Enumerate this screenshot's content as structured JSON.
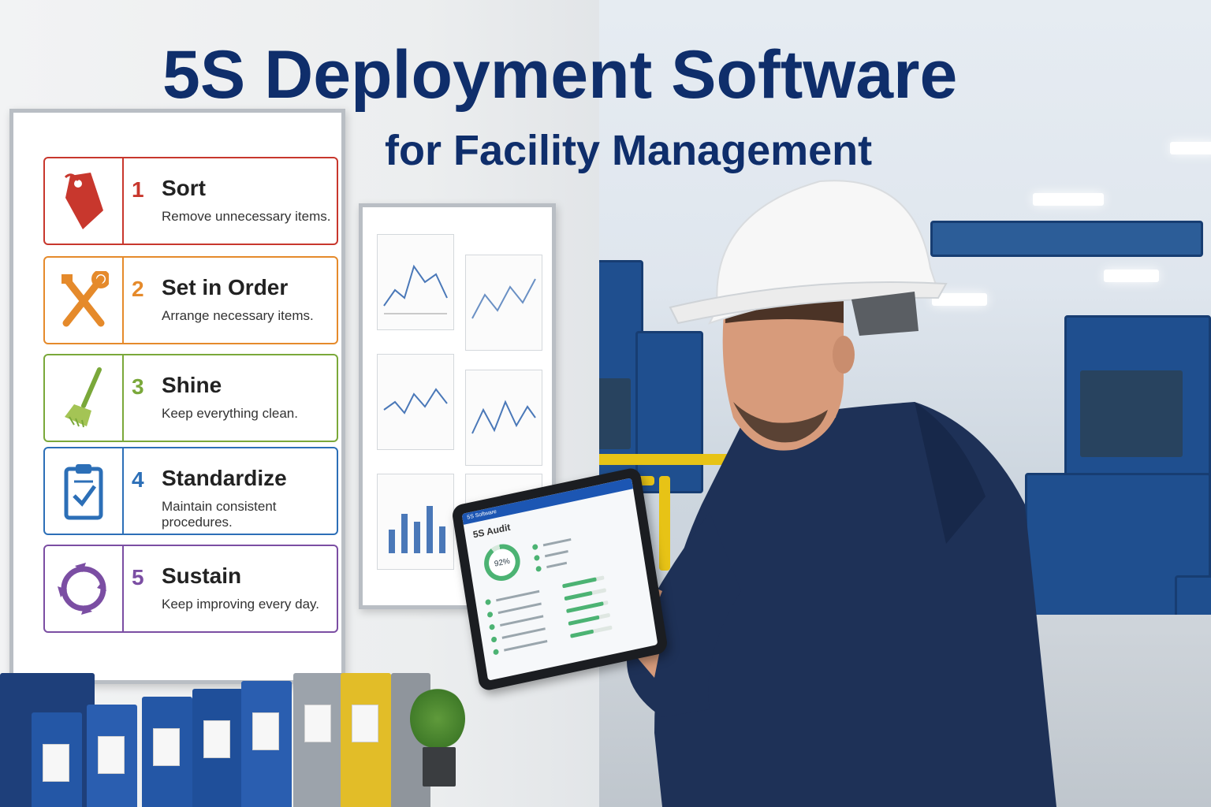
{
  "heading": {
    "title": "5S Deployment Software",
    "subtitle": "for Facility Management"
  },
  "board_5s": {
    "steps": [
      {
        "number": "1",
        "title": "Sort",
        "description": "Remove unnecessary items.",
        "icon": "tag-icon",
        "color": "#c8372d"
      },
      {
        "number": "2",
        "title": "Set in Order",
        "description": "Arrange necessary items.",
        "icon": "tools-icon",
        "color": "#e58a2b"
      },
      {
        "number": "3",
        "title": "Shine",
        "description": "Keep everything clean.",
        "icon": "broom-icon",
        "color": "#7aa83a"
      },
      {
        "number": "4",
        "title": "Standardize",
        "description": "Maintain consistent procedures.",
        "icon": "clipboard-check-icon",
        "color": "#2c6fb7"
      },
      {
        "number": "5",
        "title": "Sustain",
        "description": "Keep improving every day.",
        "icon": "cycle-arrows-icon",
        "color": "#7b4ea3"
      }
    ]
  },
  "tablet": {
    "app_name": "5S Software",
    "screen_title": "5S Audit",
    "score": "92%",
    "score_value": 0.92
  },
  "colors": {
    "heading": "#0f2e6b",
    "uniform": "#1e3157",
    "helmet": "#f7f7f7",
    "machine_blue": "#1f4f8f",
    "rail_yellow": "#e7c316"
  }
}
